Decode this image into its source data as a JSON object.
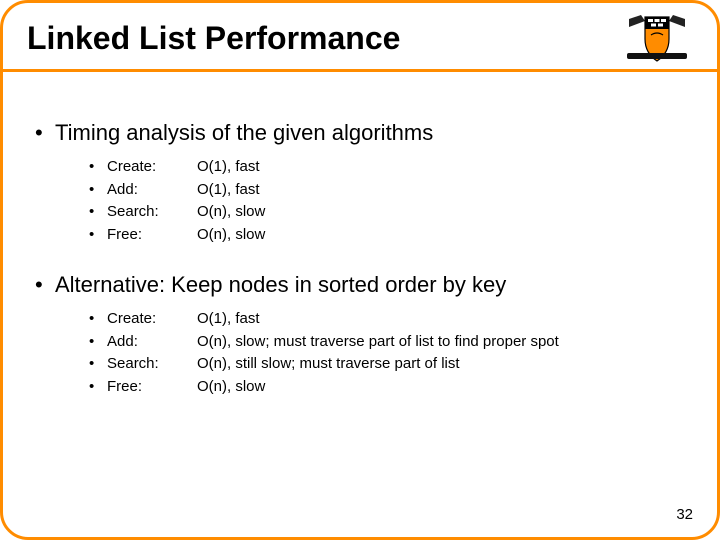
{
  "title": "Linked List Performance",
  "section1": {
    "heading": "Timing analysis of the given algorithms",
    "items": [
      {
        "label": "Create:",
        "value": "O(1), fast"
      },
      {
        "label": "Add:",
        "value": "O(1), fast"
      },
      {
        "label": "Search:",
        "value": "O(n), slow"
      },
      {
        "label": "Free:",
        "value": "O(n), slow"
      }
    ]
  },
  "section2": {
    "heading": "Alternative: Keep nodes in sorted order by key",
    "items": [
      {
        "label": "Create:",
        "value": "O(1), fast"
      },
      {
        "label": "Add:",
        "value": "O(n), slow; must traverse part of list to find proper spot"
      },
      {
        "label": "Search:",
        "value": "O(n), still slow; must traverse part of list"
      },
      {
        "label": "Free:",
        "value": "O(n), slow"
      }
    ]
  },
  "page_number": "32"
}
